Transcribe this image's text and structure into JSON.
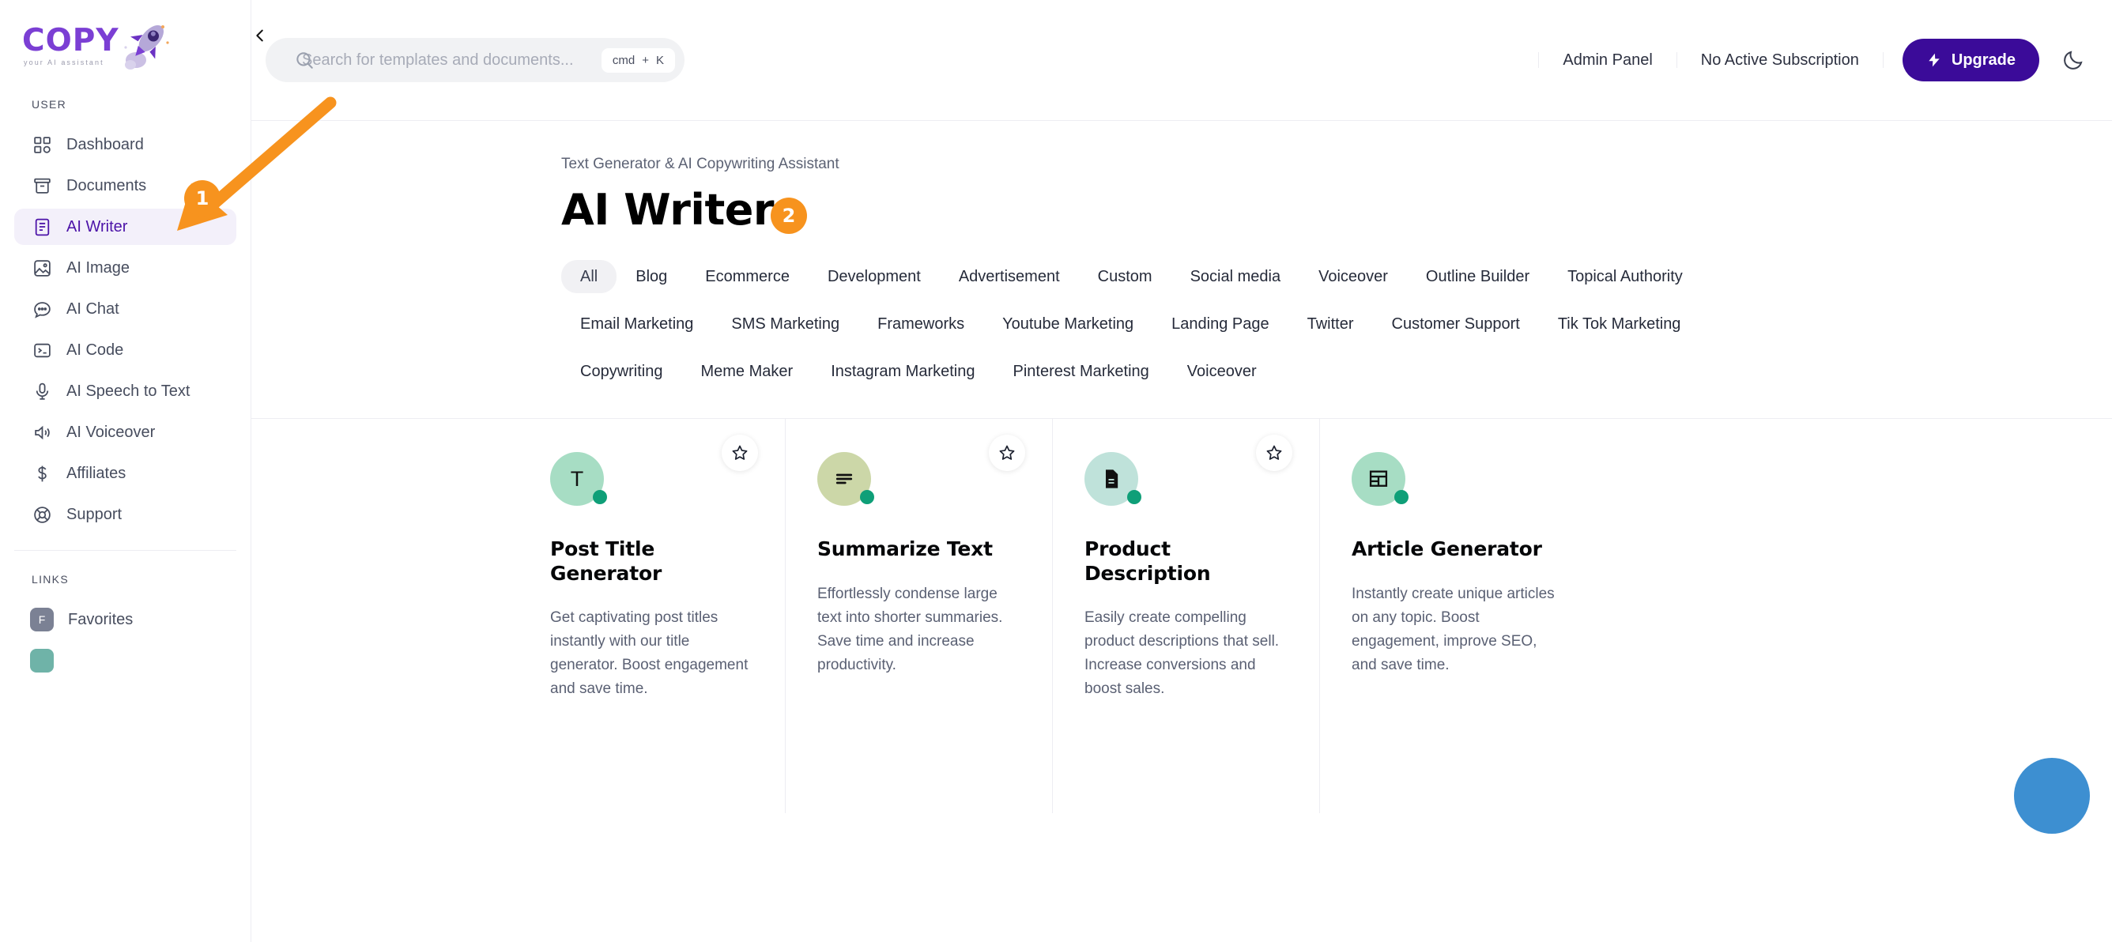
{
  "brand": {
    "name": "COPY",
    "tagline": "your AI assistant",
    "logo_color": "#7b3fd4"
  },
  "sidebar": {
    "user_section_label": "USER",
    "links_section_label": "LINKS",
    "items": [
      {
        "label": "Dashboard",
        "icon": "grid-icon",
        "active": false
      },
      {
        "label": "Documents",
        "icon": "archive-icon",
        "active": false
      },
      {
        "label": "AI Writer",
        "icon": "document-text-icon",
        "active": true
      },
      {
        "label": "AI Image",
        "icon": "image-icon",
        "active": false
      },
      {
        "label": "AI Chat",
        "icon": "chat-bubble-icon",
        "active": false
      },
      {
        "label": "AI Code",
        "icon": "terminal-icon",
        "active": false
      },
      {
        "label": "AI Speech to Text",
        "icon": "microphone-icon",
        "active": false
      },
      {
        "label": "AI Voiceover",
        "icon": "speaker-icon",
        "active": false
      },
      {
        "label": "Affiliates",
        "icon": "dollar-icon",
        "active": false
      },
      {
        "label": "Support",
        "icon": "lifebuoy-icon",
        "active": false
      }
    ],
    "links": [
      {
        "label": "Favorites",
        "badge": "F",
        "badge_color": "#7b8194"
      }
    ]
  },
  "topbar": {
    "collapse_icon": "chevron-left-icon",
    "search": {
      "placeholder": "Search for templates and documents...",
      "value": "",
      "icon": "search-icon",
      "shortcut_key": "cmd",
      "shortcut_plus": "+",
      "shortcut_letter": "K"
    },
    "admin_panel_label": "Admin Panel",
    "subscription_label": "No Active Subscription",
    "upgrade_label": "Upgrade",
    "upgrade_icon": "bolt-icon",
    "upgrade_color": "#3b0b99",
    "theme_toggle_icon": "moon-icon"
  },
  "page": {
    "eyebrow": "Text Generator & AI Copywriting Assistant",
    "title": "AI Writer"
  },
  "tabs": {
    "rows": [
      [
        {
          "label": "All",
          "active": true
        },
        {
          "label": "Blog",
          "active": false
        },
        {
          "label": "Ecommerce",
          "active": false
        },
        {
          "label": "Development",
          "active": false
        },
        {
          "label": "Advertisement",
          "active": false
        },
        {
          "label": "Custom",
          "active": false
        },
        {
          "label": "Social media",
          "active": false
        },
        {
          "label": "Voiceover",
          "active": false
        },
        {
          "label": "Outline Builder",
          "active": false
        },
        {
          "label": "Topical Authority",
          "active": false
        }
      ],
      [
        {
          "label": "Email Marketing",
          "active": false
        },
        {
          "label": "SMS Marketing",
          "active": false
        },
        {
          "label": "Frameworks",
          "active": false
        },
        {
          "label": "Youtube Marketing",
          "active": false
        },
        {
          "label": "Landing Page",
          "active": false
        },
        {
          "label": "Twitter",
          "active": false
        },
        {
          "label": "Customer Support",
          "active": false
        },
        {
          "label": "Tik Tok Marketing",
          "active": false
        }
      ],
      [
        {
          "label": "Copywriting",
          "active": false
        },
        {
          "label": "Meme Maker",
          "active": false
        },
        {
          "label": "Instagram Marketing",
          "active": false
        },
        {
          "label": "Pinterest Marketing",
          "active": false
        },
        {
          "label": "Voiceover",
          "active": false
        }
      ]
    ]
  },
  "cards": [
    {
      "title": "Post Title Generator",
      "description": "Get captivating post titles instantly with our title generator. Boost engagement and save time.",
      "icon": "letter-t-icon",
      "icon_glyph": "T",
      "icon_bg": "#a7ddc4",
      "status_dot_color": "#0f9f78",
      "favorite_icon": "star-outline-icon",
      "has_favorite": true
    },
    {
      "title": "Summarize Text",
      "description": "Effortlessly condense large text into shorter summaries. Save time and increase productivity.",
      "icon": "text-lines-icon",
      "icon_glyph": "",
      "icon_bg": "#ccd7a8",
      "status_dot_color": "#0f9f78",
      "favorite_icon": "star-outline-icon",
      "has_favorite": true
    },
    {
      "title": "Product Description",
      "description": "Easily create compelling product descriptions that sell. Increase conversions and boost sales.",
      "icon": "document-icon",
      "icon_glyph": "",
      "icon_bg": "#bfe2da",
      "status_dot_color": "#0f9f78",
      "favorite_icon": "star-outline-icon",
      "has_favorite": true
    },
    {
      "title": "Article Generator",
      "description": "Instantly create unique articles on any topic. Boost engagement, improve SEO, and save time.",
      "icon": "layout-table-icon",
      "icon_glyph": "",
      "icon_bg": "#a7ddc4",
      "status_dot_color": "#0f9f78",
      "favorite_icon": "star-outline-icon",
      "has_favorite": false
    }
  ],
  "annotations": {
    "color": "#f7931e",
    "badges": [
      {
        "number": "1",
        "target": "AI Writer"
      },
      {
        "number": "2",
        "target": "Youtube Marketing"
      }
    ]
  },
  "chat_fab": {
    "icon": "chat-support-icon",
    "color": "#3d8fd1"
  }
}
